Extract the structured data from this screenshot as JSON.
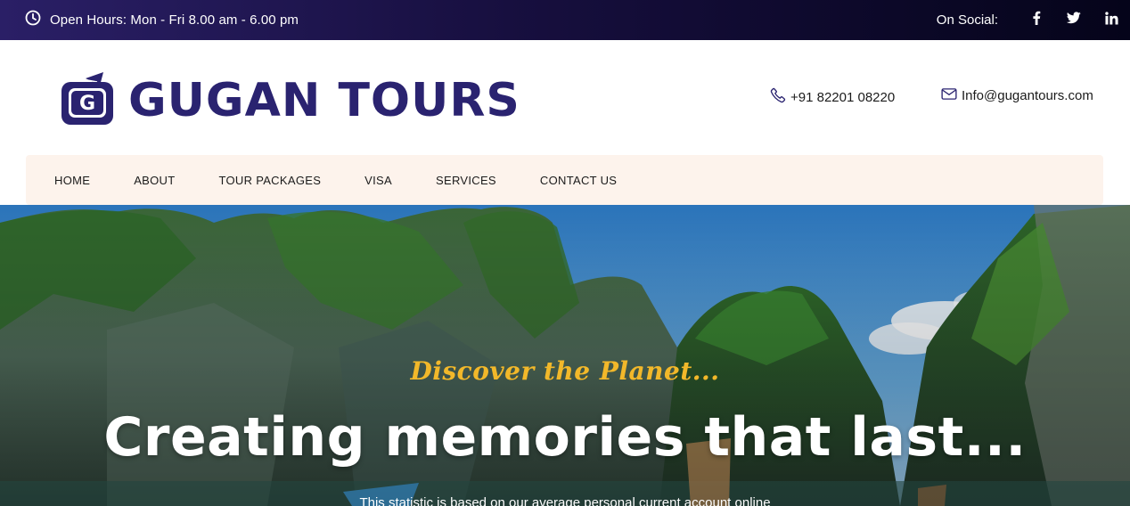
{
  "topbar": {
    "hours_text": "Open Hours: Mon - Fri 8.00 am - 6.00 pm",
    "social_label": "On Social:",
    "social": [
      {
        "icon": "facebook-icon"
      },
      {
        "icon": "twitter-icon"
      },
      {
        "icon": "linkedin-icon"
      }
    ],
    "bg_color": "#170f3f"
  },
  "header": {
    "logo_letter": "G",
    "logo_text": "GUGAN TOURS",
    "phone": "+91 82201 08220",
    "email": "Info@gugantours.com",
    "brand_color": "#2a2370"
  },
  "nav": {
    "items": [
      {
        "label": "HOME"
      },
      {
        "label": "ABOUT"
      },
      {
        "label": "TOUR PACKAGES"
      },
      {
        "label": "VISA"
      },
      {
        "label": "SERVICES"
      },
      {
        "label": "CONTACT US"
      }
    ],
    "bg_color": "#fdf3ec"
  },
  "hero": {
    "subtitle": "Discover the Planet...",
    "title": "Creating memories that last...",
    "description": "This statistic is based on our average personal current account online",
    "accent_color": "#f2b82a"
  }
}
